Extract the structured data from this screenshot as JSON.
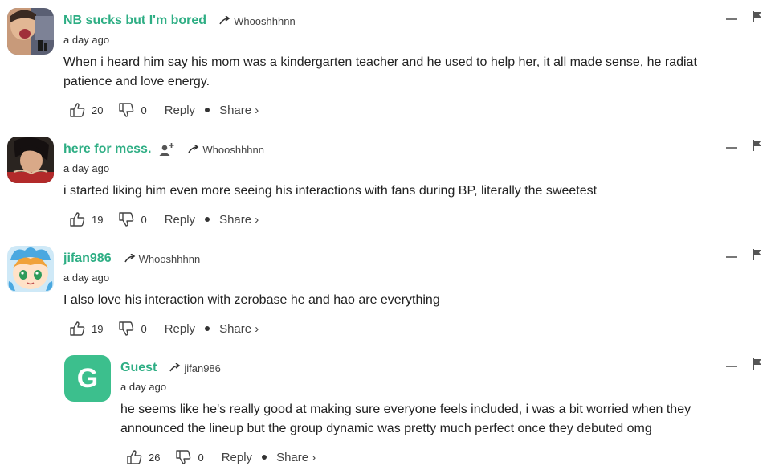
{
  "colors": {
    "username": "#2eae84",
    "guest_avatar_bg": "#3cbf8d",
    "text": "#222222",
    "meta": "#444444"
  },
  "comments": [
    {
      "username": "NB sucks but I'm bored",
      "reply_to": "Whooshhhnn",
      "time": "a day ago",
      "text_line1": "When i heard him say his mom was a kindergarten teacher and he used to help her, it all made sense, he radiat",
      "text_line2": "patience and love energy.",
      "upvotes": "20",
      "downvotes": "0",
      "reply_label": "Reply",
      "share_label": "Share ›",
      "avatar": "photo-avatar"
    },
    {
      "username": "here for mess.",
      "reply_to": "Whooshhhnn",
      "time": "a day ago",
      "text_line1": "i started liking him even more seeing his interactions with fans during BP, literally the sweetest",
      "upvotes": "19",
      "downvotes": "0",
      "reply_label": "Reply",
      "share_label": "Share ›",
      "avatar": "photo-avatar"
    },
    {
      "username": "jifan986",
      "reply_to": "Whooshhhnn",
      "time": "a day ago",
      "text_line1": "I also love his interaction with zerobase he and hao are everything",
      "upvotes": "19",
      "downvotes": "0",
      "reply_label": "Reply",
      "share_label": "Share ›",
      "avatar": "cartoon-avatar"
    },
    {
      "username": "Guest",
      "reply_to": "jifan986",
      "time": "a day ago",
      "text_line1": "he seems like he's really good at making sure everyone feels included, i was a bit worried when they",
      "text_line2": "announced the lineup but the group dynamic was pretty much perfect once they debuted omg",
      "upvotes": "26",
      "downvotes": "0",
      "reply_label": "Reply",
      "share_label": "Share ›",
      "avatar_letter": "G"
    }
  ]
}
